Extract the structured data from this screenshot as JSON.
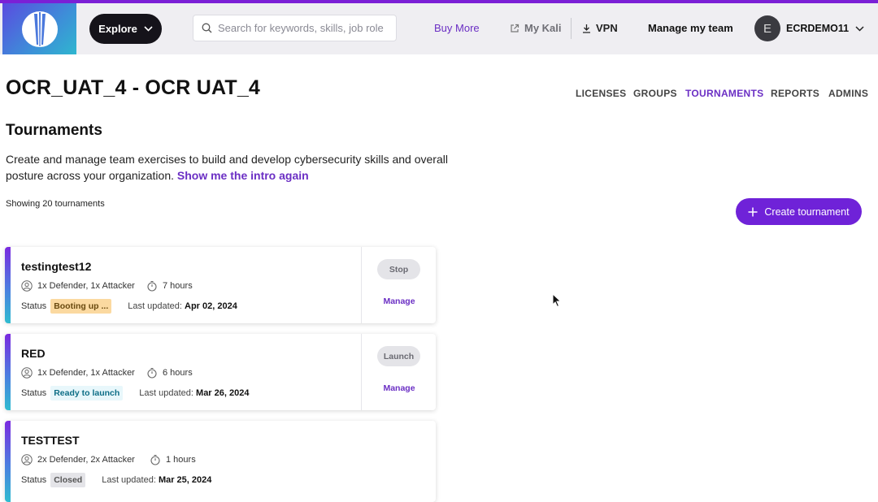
{
  "navbar": {
    "explore_label": "Explore",
    "search_placeholder": "Search for keywords, skills, job role",
    "buy_more": "Buy More",
    "my_kali": "My Kali",
    "vpn": "VPN",
    "manage_team": "Manage my team",
    "avatar_initial": "E",
    "username": "ECRDEMO11"
  },
  "page": {
    "title": "OCR_UAT_4 - OCR UAT_4",
    "subnav": [
      "LICENSES",
      "GROUPS",
      "TOURNAMENTS",
      "REPORTS",
      "ADMINS"
    ],
    "active_subnav": "TOURNAMENTS",
    "section_title": "Tournaments",
    "description": "Create and manage team exercises to build and develop cybersecurity skills and overall posture across your organization.",
    "intro_link": "Show me the intro again",
    "showing": "Showing 20 tournaments",
    "create_label": "Create tournament"
  },
  "tournaments": [
    {
      "name": "testingtest12",
      "roles": "1x Defender, 1x Attacker",
      "duration": "7 hours",
      "status_label": "Status",
      "status": "Booting up ...",
      "updated_label": "Last updated:",
      "updated": "Apr 02, 2024",
      "action": "Stop",
      "manage": "Manage"
    },
    {
      "name": "RED",
      "roles": "1x Defender, 1x Attacker",
      "duration": "6 hours",
      "status_label": "Status",
      "status": "Ready to launch",
      "updated_label": "Last updated:",
      "updated": "Mar 26, 2024",
      "action": "Launch",
      "manage": "Manage"
    },
    {
      "name": "TESTTEST",
      "roles": "2x Defender, 2x Attacker",
      "duration": "1 hours",
      "status_label": "Status",
      "status": "Closed",
      "updated_label": "Last updated:",
      "updated": "Mar 25, 2024"
    }
  ],
  "colors": {
    "brand_purple": "#6f22d8",
    "link_purple": "#6b2fc4",
    "booting_badge": "#fbd9a0",
    "ready_badge": "#e8f7fb",
    "closed_badge": "#e4e4e8"
  }
}
